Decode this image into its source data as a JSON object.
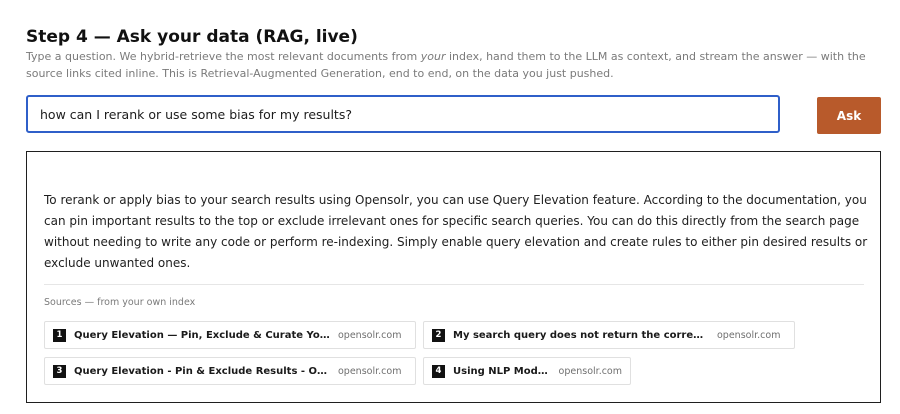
{
  "header": {
    "title": "Step 4 — Ask your data (RAG, live)",
    "desc_part1": "Type a question. We hybrid-retrieve the most relevant documents from ",
    "desc_emphasis": "your",
    "desc_part2": " index, hand them to the LLM as context, and stream the answer — with the source links cited inline. This is Retrieval-Augmented Generation, end to end, on the data you just pushed."
  },
  "search": {
    "value": "how can I rerank or use some bias for my results?",
    "ask_label": "Ask"
  },
  "answer": {
    "text": "To rerank or apply bias to your search results using Opensolr, you can use Query Elevation feature. According to the documentation, you can pin important results to the top or exclude irrelevant ones for specific search queries. You can do this directly from the search page without needing to write any code or perform re-indexing. Simply enable query elevation and create rules to either pin desired results or exclude unwanted ones."
  },
  "sources": {
    "label": "Sources — from your own index",
    "items": [
      {
        "num": "1",
        "title": "Query Elevation — Pin, Exclude & Curate Your Search Results",
        "domain": "opensolr.com"
      },
      {
        "num": "2",
        "title": "My search query does not return the correct results",
        "domain": "opensolr.com"
      },
      {
        "num": "3",
        "title": "Query Elevation - Pin & Exclude Results - Opensolr",
        "domain": "opensolr.com"
      },
      {
        "num": "4",
        "title": "Using NLP Models",
        "domain": "opensolr.com"
      }
    ]
  }
}
